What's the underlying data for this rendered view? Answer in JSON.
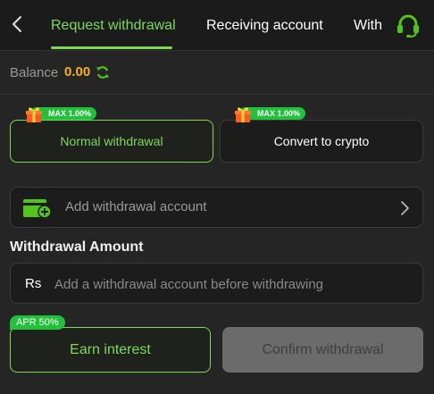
{
  "header": {
    "tabs": [
      {
        "label": "Request withdrawal",
        "active": true
      },
      {
        "label": "Receiving account",
        "active": false
      },
      {
        "label": "With",
        "active": false
      }
    ],
    "accent": "#7ed957"
  },
  "balance": {
    "label": "Balance",
    "value": "0.00"
  },
  "withdraw_types": [
    {
      "label": "Normal withdrawal",
      "badge": "MAX 1.00%",
      "selected": true
    },
    {
      "label": "Convert to crypto",
      "badge": "MAX 1.00%",
      "selected": false
    }
  ],
  "account": {
    "label": "Add withdrawal account"
  },
  "amount": {
    "title": "Withdrawal Amount",
    "currency": "Rs",
    "placeholder": "Add a withdrawal account before withdrawing"
  },
  "actions": {
    "apr_badge": "APR 50%",
    "earn_label": "Earn interest",
    "confirm_label": "Confirm withdrawal"
  }
}
